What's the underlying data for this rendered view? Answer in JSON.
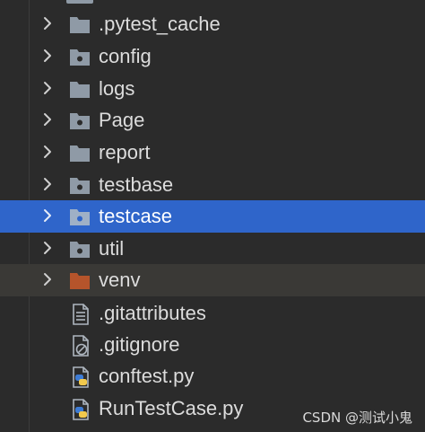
{
  "colors": {
    "background": "#2b2b2b",
    "selection": "#2f65ca",
    "excluded_row": "#3a3936",
    "folder_gray": "#8f9aa6",
    "folder_excluded": "#b5542b",
    "text": "#dcdcdc"
  },
  "tree": {
    "items": [
      {
        "label": ".pytest_cache",
        "icon": "folder-icon"
      },
      {
        "label": "config",
        "icon": "package-folder-icon"
      },
      {
        "label": "logs",
        "icon": "folder-icon"
      },
      {
        "label": "Page",
        "icon": "package-folder-icon"
      },
      {
        "label": "report",
        "icon": "folder-icon"
      },
      {
        "label": "testbase",
        "icon": "package-folder-icon"
      },
      {
        "label": "testcase",
        "icon": "package-folder-icon",
        "selected": true
      },
      {
        "label": "util",
        "icon": "package-folder-icon"
      },
      {
        "label": "venv",
        "icon": "excluded-folder-icon"
      },
      {
        "label": ".gitattributes",
        "icon": "text-file-icon"
      },
      {
        "label": ".gitignore",
        "icon": "ignore-file-icon"
      },
      {
        "label": "conftest.py",
        "icon": "python-file-icon"
      },
      {
        "label": "RunTestCase.py",
        "icon": "python-file-icon"
      }
    ]
  },
  "watermark": "CSDN @测试小鬼"
}
